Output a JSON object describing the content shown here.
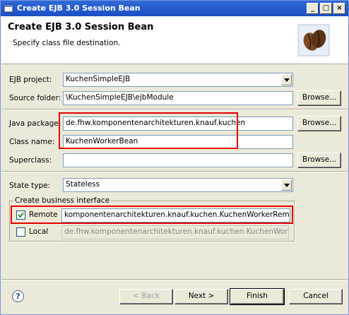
{
  "window": {
    "title": "Create EJB 3.0 Session Bean",
    "controls": {
      "minimize": "_",
      "maximize": "□",
      "close": "×"
    }
  },
  "header": {
    "title": "Create EJB 3.0 Session Bean",
    "subtitle": "Specify class file destination."
  },
  "form": {
    "ejb_project": {
      "label": "EJB project:",
      "value": "KuchenSimpleEJB"
    },
    "source_folder": {
      "label": "Source folder:",
      "value": "\\KuchenSimpleEJB\\ejbModule",
      "button": "Browse..."
    },
    "java_package": {
      "label": "Java package:",
      "value": "de.fhw.komponentenarchitekturen.knauf.kuchen",
      "button": "Browse..."
    },
    "class_name": {
      "label": "Class name:",
      "value": "KuchenWorkerBean"
    },
    "superclass": {
      "label": "Superclass:",
      "value": "",
      "button": "Browse..."
    },
    "state_type": {
      "label": "State type:",
      "value": "Stateless"
    },
    "business_interface": {
      "group_label": "Create business interface",
      "remote": {
        "label": "Remote",
        "checked": true,
        "value": "komponentenarchitekturen.knauf.kuchen.KuchenWorkerRemote"
      },
      "local": {
        "label": "Local",
        "checked": false,
        "value": "de.fhw.komponentenarchitekturen.knauf.kuchen.KuchenWorkerL"
      }
    }
  },
  "footer": {
    "help": "?",
    "back": "< Back",
    "next": "Next >",
    "finish": "Finish",
    "cancel": "Cancel"
  },
  "colors": {
    "highlight_box": "#e60000",
    "titlebar": "#2f6ad6"
  }
}
